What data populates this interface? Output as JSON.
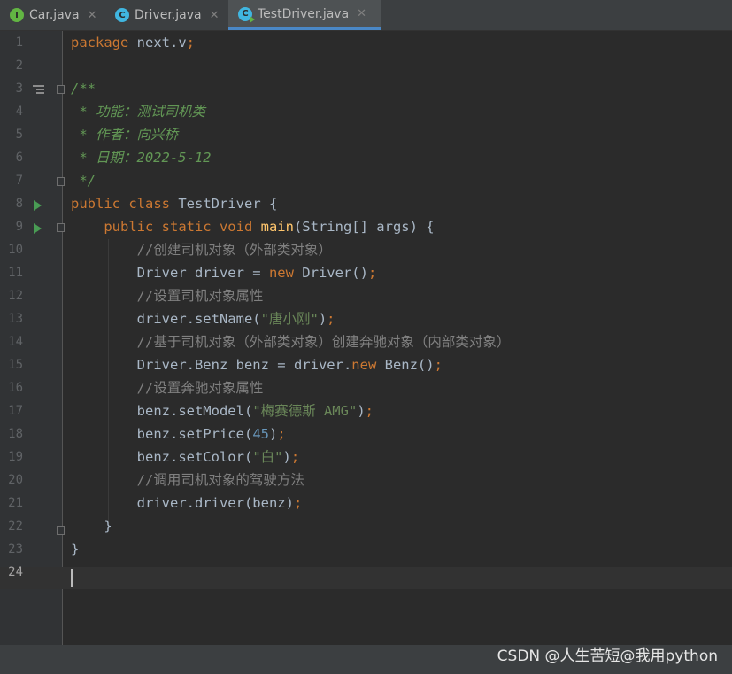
{
  "tabs": [
    {
      "label": "Car.java",
      "icon": "interface-icon",
      "glyph": "I",
      "close": "✕"
    },
    {
      "label": "Driver.java",
      "icon": "class-icon",
      "glyph": "C",
      "close": "✕"
    },
    {
      "label": "TestDriver.java",
      "icon": "runnable-class-icon",
      "glyph": "C",
      "close": "✕",
      "active": true
    }
  ],
  "line_numbers": [
    "1",
    "2",
    "3",
    "4",
    "5",
    "6",
    "7",
    "8",
    "9",
    "10",
    "11",
    "12",
    "13",
    "14",
    "15",
    "16",
    "17",
    "18",
    "19",
    "20",
    "21",
    "22",
    "23",
    "24"
  ],
  "code": {
    "l1": {
      "a": "package ",
      "b": "next.v",
      "c": ";"
    },
    "l3": "/**",
    "l4": " * 功能：测试司机类",
    "l5": " * 作者：向兴桥",
    "l6": " * 日期：2022-5-12",
    "l7": " */",
    "l8": {
      "a": "public class ",
      "b": "TestDriver {"
    },
    "l9": {
      "a": "    public static void ",
      "b": "main",
      "c": "(String[] args) {"
    },
    "l10": "        //创建司机对象（外部类对象）",
    "l11": {
      "a": "        Driver driver = ",
      "b": "new ",
      "c": "Driver()",
      "d": ";"
    },
    "l12": "        //设置司机对象属性",
    "l13": {
      "a": "        driver.setName(",
      "b": "\"唐小刚\"",
      "c": ")",
      "d": ";"
    },
    "l14": "        //基于司机对象（外部类对象）创建奔驰对象（内部类对象）",
    "l15": {
      "a": "        Driver.Benz benz = driver.",
      "b": "new ",
      "c": "Benz()",
      "d": ";"
    },
    "l16": "        //设置奔驰对象属性",
    "l17": {
      "a": "        benz.setModel(",
      "b": "\"梅赛德斯 AMG\"",
      "c": ")",
      "d": ";"
    },
    "l18": {
      "a": "        benz.setPrice(",
      "b": "45",
      "c": ")",
      "d": ";"
    },
    "l19": {
      "a": "        benz.setColor(",
      "b": "\"白\"",
      "c": ")",
      "d": ";"
    },
    "l20": "        //调用司机对象的驾驶方法",
    "l21": {
      "a": "        driver.driver(benz)",
      "b": ";"
    },
    "l22": "    }",
    "l23": "}"
  },
  "watermark": "CSDN @人生苦短@我用python",
  "colors": {
    "keyword": "#cc7832",
    "string": "#6a8759",
    "number": "#6897bb",
    "doc": "#629755",
    "comment": "#808080",
    "method": "#ffc66d",
    "text": "#a9b7c6"
  }
}
